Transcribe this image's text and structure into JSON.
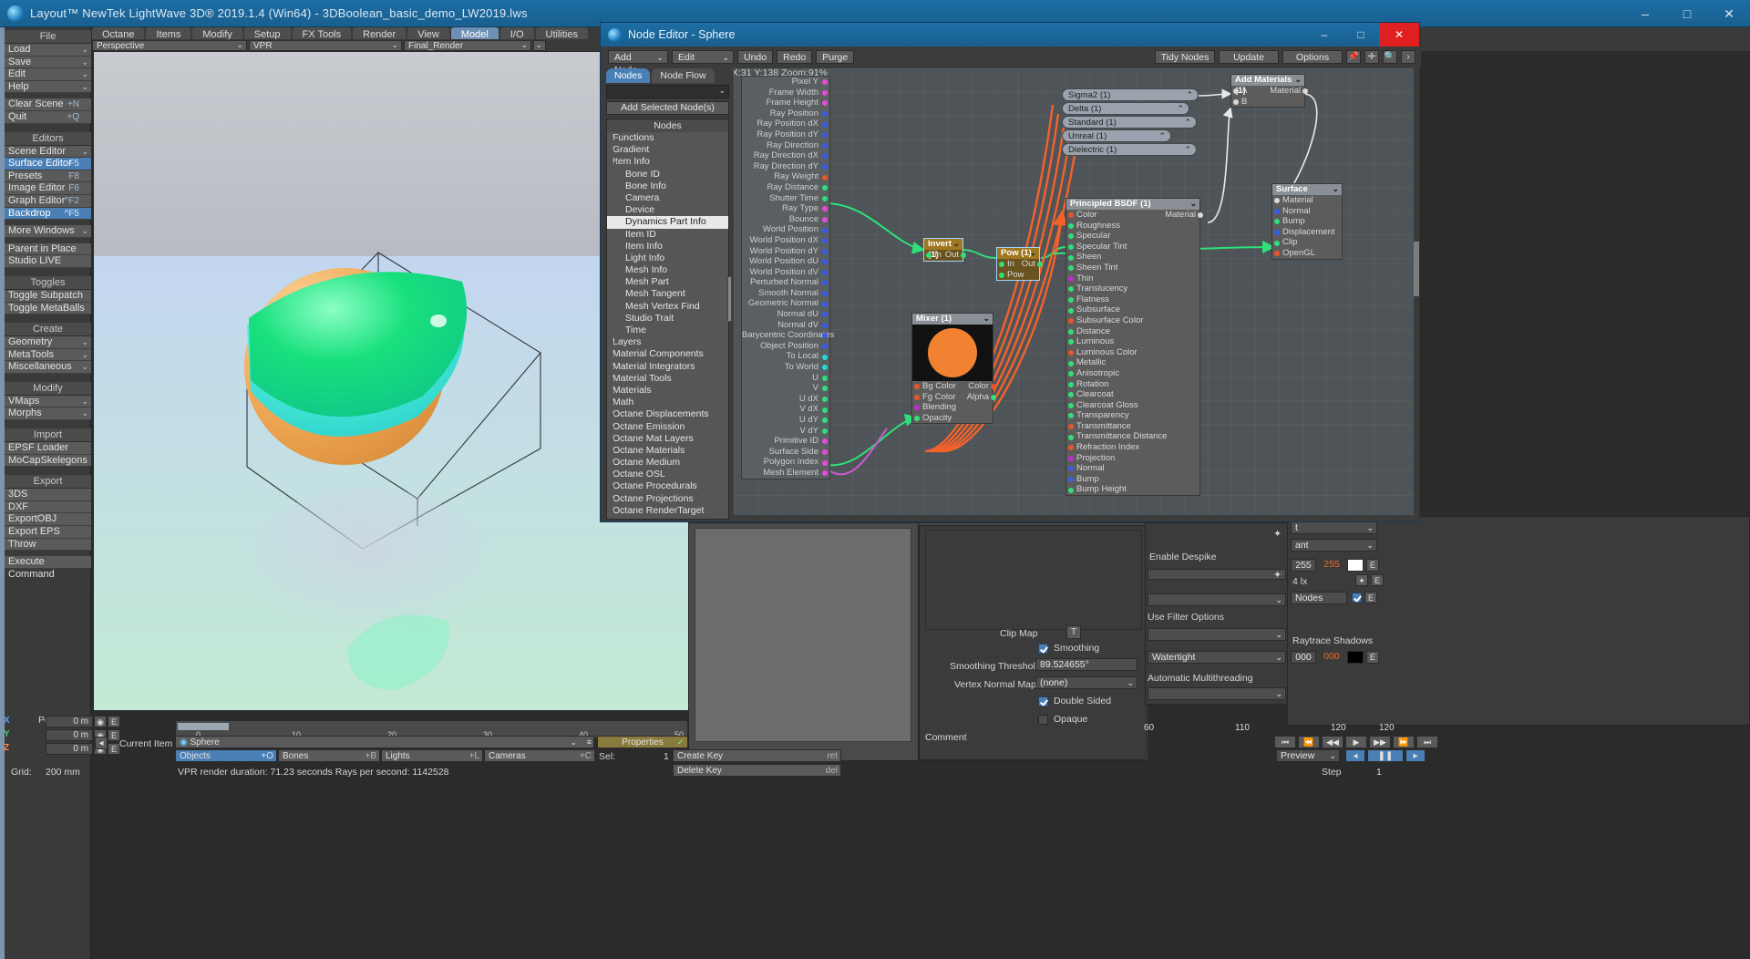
{
  "window": {
    "title": "Layout™ NewTek LightWave 3D® 2019.1.4 (Win64) - 3DBoolean_basic_demo_LW2019.lws",
    "minimize": "–",
    "maximize": "□",
    "close": "✕"
  },
  "sidebar": {
    "sections": [
      {
        "head": "File",
        "items": [
          {
            "label": "Load",
            "chev": "⌄"
          },
          {
            "label": "Save",
            "chev": "⌄"
          },
          {
            "label": "Edit",
            "chev": "⌄"
          },
          {
            "label": "Help",
            "chev": "⌄"
          }
        ]
      },
      {
        "head": "",
        "items": [
          {
            "label": "Clear Scene",
            "key": "+N"
          },
          {
            "label": "Quit",
            "key": "+Q"
          }
        ]
      },
      {
        "head": "Editors",
        "items": [
          {
            "label": "Scene Editor",
            "chev": "⌄"
          },
          {
            "label": "Surface Editor",
            "key": "F5",
            "sel": true
          },
          {
            "label": "Presets",
            "key": "F8"
          },
          {
            "label": "Image Editor",
            "key": "F6"
          },
          {
            "label": "Graph Editor",
            "key": "^F2"
          },
          {
            "label": "Backdrop",
            "key": "^F5",
            "sel": true
          }
        ]
      },
      {
        "head": "",
        "items": [
          {
            "label": "More Windows",
            "chev": "⌄"
          }
        ]
      },
      {
        "head": "",
        "items": [
          {
            "label": "Parent in Place"
          },
          {
            "label": "Studio LIVE"
          }
        ]
      },
      {
        "head": "Toggles",
        "items": [
          {
            "label": "Toggle Subpatch"
          },
          {
            "label": "Toggle MetaBalls"
          }
        ]
      },
      {
        "head": "Create",
        "items": [
          {
            "label": "Geometry",
            "chev": "⌄"
          },
          {
            "label": "MetaTools",
            "chev": "⌄"
          },
          {
            "label": "Miscellaneous",
            "chev": "⌄"
          }
        ]
      },
      {
        "head": "Modify",
        "items": [
          {
            "label": "VMaps",
            "chev": "⌄"
          },
          {
            "label": "Morphs",
            "chev": "⌄"
          }
        ]
      },
      {
        "head": "Import",
        "items": [
          {
            "label": "EPSF Loader"
          },
          {
            "label": "MoCapSkelegons"
          }
        ]
      },
      {
        "head": "Export",
        "items": [
          {
            "label": "3DS"
          },
          {
            "label": "DXF"
          },
          {
            "label": "ExportOBJ"
          },
          {
            "label": "Export EPS"
          },
          {
            "label": "Throw"
          }
        ]
      },
      {
        "head": "",
        "items": [
          {
            "label": "Execute Command"
          }
        ]
      }
    ]
  },
  "tabs": [
    {
      "label": "Octane",
      "active": false
    },
    {
      "label": "Items",
      "active": false
    },
    {
      "label": "Modify",
      "active": false
    },
    {
      "label": "Setup",
      "active": false
    },
    {
      "label": "FX Tools",
      "active": false
    },
    {
      "label": "Render",
      "active": false
    },
    {
      "label": "View",
      "active": false
    },
    {
      "label": "Model",
      "active": true
    },
    {
      "label": "I/O",
      "active": false
    },
    {
      "label": "Utilities",
      "active": false
    }
  ],
  "viewport_toolbar": {
    "view": "Perspective",
    "render_mode": "VPR",
    "render_target": "Final_Render"
  },
  "node_editor": {
    "title": "Node Editor - Sphere",
    "window_buttons": {
      "min": "–",
      "max": "□",
      "close": "✕"
    },
    "toolbar": {
      "add_node": "Add Node",
      "edit": "Edit",
      "undo": "Undo",
      "redo": "Redo",
      "purge": "Purge",
      "tidy_nodes": "Tidy Nodes",
      "update": "Update",
      "options": "Options",
      "icons": [
        "pin-icon",
        "move-icon",
        "search-icon",
        "chevron-right-icon"
      ]
    },
    "tabs": [
      {
        "label": "Nodes",
        "active": true
      },
      {
        "label": "Node Flow",
        "active": false
      }
    ],
    "search_placeholder": "",
    "add_selected": "Add Selected Node(s)",
    "tree_header": "Nodes",
    "tree": [
      {
        "label": "Functions",
        "arrow": "›",
        "level": 0
      },
      {
        "label": "Gradient",
        "arrow": "›",
        "level": 0
      },
      {
        "label": "Item Info",
        "arrow": "⌄",
        "level": 0
      },
      {
        "label": "Bone ID",
        "level": 1
      },
      {
        "label": "Bone Info",
        "level": 1
      },
      {
        "label": "Camera",
        "level": 1
      },
      {
        "label": "Device",
        "level": 1
      },
      {
        "label": "Dynamics Part Info",
        "level": 1,
        "sel": true
      },
      {
        "label": "Item ID",
        "level": 1
      },
      {
        "label": "Item Info",
        "level": 1
      },
      {
        "label": "Light Info",
        "level": 1
      },
      {
        "label": "Mesh Info",
        "level": 1
      },
      {
        "label": "Mesh Part",
        "level": 1
      },
      {
        "label": "Mesh Tangent",
        "level": 1
      },
      {
        "label": "Mesh Vertex Find",
        "level": 1
      },
      {
        "label": "Studio Trait",
        "level": 1
      },
      {
        "label": "Time",
        "level": 1
      },
      {
        "label": "Layers",
        "arrow": "›",
        "level": 0
      },
      {
        "label": "Material Components",
        "arrow": "›",
        "level": 0
      },
      {
        "label": "Material Integrators",
        "arrow": "›",
        "level": 0
      },
      {
        "label": "Material Tools",
        "arrow": "›",
        "level": 0
      },
      {
        "label": "Materials",
        "arrow": "›",
        "level": 0
      },
      {
        "label": "Math",
        "arrow": "›",
        "level": 0
      },
      {
        "label": "Octane Displacements",
        "arrow": "›",
        "level": 0
      },
      {
        "label": "Octane Emission",
        "arrow": "›",
        "level": 0
      },
      {
        "label": "Octane Mat Layers",
        "arrow": "›",
        "level": 0
      },
      {
        "label": "Octane Materials",
        "arrow": "›",
        "level": 0
      },
      {
        "label": "Octane Medium",
        "arrow": "›",
        "level": 0
      },
      {
        "label": "Octane OSL",
        "arrow": "›",
        "level": 0
      },
      {
        "label": "Octane Procedurals",
        "arrow": "›",
        "level": 0
      },
      {
        "label": "Octane Projections",
        "arrow": "›",
        "level": 0
      },
      {
        "label": "Octane RenderTarget",
        "arrow": "›",
        "level": 0
      }
    ],
    "canvas_status": "X:31 Y:138 Zoom:91%",
    "input_node": {
      "ports": [
        "Pixel Y",
        "Frame Width",
        "Frame Height",
        "Ray Position",
        "Ray Position dX",
        "Ray Position dY",
        "Ray Direction",
        "Ray Direction dX",
        "Ray Direction dY",
        "Ray Weight",
        "Ray Distance",
        "Shutter Time",
        "Ray Type",
        "Bounce",
        "World Position",
        "World Position dX",
        "World Position dY",
        "World Position dU",
        "World Position dV",
        "Perturbed Normal",
        "Smooth Normal",
        "Geometric Normal",
        "Normal dU",
        "Normal dV",
        "Barycentric Coordinates",
        "Object Position",
        "To Local",
        "To World",
        "U",
        "V",
        "U dX",
        "V dX",
        "U dY",
        "V dY",
        "Primitive ID",
        "Surface Side",
        "Polygon Index",
        "Mesh Element"
      ]
    },
    "invert_node": {
      "title": "Invert (1)",
      "in": "In",
      "out": "Out"
    },
    "pow_node": {
      "title": "Pow (1)",
      "in": "In",
      "pow": "Pow",
      "out": "Out"
    },
    "mixer_node": {
      "title": "Mixer (1)",
      "inputs": [
        "Bg Color",
        "Fg Color",
        "Blending",
        "Opacity"
      ],
      "outputs": [
        "Color",
        "Alpha"
      ],
      "swatch_color": "#f08232"
    },
    "collapsed_nodes": [
      {
        "title": "Sigma2 (1)"
      },
      {
        "title": "Delta (1)"
      },
      {
        "title": "Standard (1)"
      },
      {
        "title": "Unreal (1)"
      },
      {
        "title": "Dielectric (1)"
      }
    ],
    "add_materials_node": {
      "title": "Add Materials (1)",
      "inputs": [
        "A",
        "B"
      ],
      "outputs": [
        "Material"
      ]
    },
    "principled_node": {
      "title": "Principled BSDF (1)",
      "output": "Material",
      "inputs": [
        "Color",
        "Roughness",
        "Specular",
        "Specular Tint",
        "Sheen",
        "Sheen Tint",
        "Thin",
        "Translucency",
        "Flatness",
        "Subsurface",
        "Subsurface Color",
        "Distance",
        "Luminous",
        "Luminous Color",
        "Metallic",
        "Anisotropic",
        "Rotation",
        "Clearcoat",
        "Clearcoat Gloss",
        "Transparency",
        "Transmittance",
        "Transmittance Distance",
        "Refraction Index",
        "Projection",
        "Normal",
        "Bump",
        "Bump Height"
      ]
    },
    "surface_node": {
      "title": "Surface",
      "inputs": [
        "Material",
        "Normal",
        "Bump",
        "Displacement",
        "Clip",
        "OpenGL"
      ]
    }
  },
  "surface_editor": {
    "enable_despike": "Enable Despike",
    "clip_map": "Clip Map",
    "clip_map_btn": "T",
    "smoothing": "Smoothing",
    "smoothing_threshold_label": "Smoothing Threshold",
    "smoothing_threshold_value": "89.524655°",
    "vertex_normal_map_label": "Vertex Normal Map",
    "vertex_normal_map_value": "(none)",
    "double_sided": "Double Sided",
    "opaque": "Opaque",
    "comment": "Comment",
    "use_filter_options": "Use Filter Options",
    "watertight": "Watertight",
    "automatic_multithreading": "Automatic Multithreading",
    "nodes_label": "Nodes",
    "raytrace_shadows": "Raytrace Shadows",
    "color_r": "255",
    "color_g": "255",
    "lux_value": "4 lx",
    "shadow_vals": [
      "000",
      "000"
    ],
    "e_btn": "E",
    "ant_label": "ant",
    "t_label": "t"
  },
  "bottom": {
    "position_label": "Position",
    "axes": [
      {
        "name": "X",
        "value": "0 m"
      },
      {
        "name": "Y",
        "value": "0 m"
      },
      {
        "name": "Z",
        "value": "0 m"
      }
    ],
    "grid_label": "Grid:",
    "grid_value": "200 mm",
    "current_item_label": "Current Item",
    "current_item_value": "Sphere",
    "objects": "Objects",
    "objects_key": "+O",
    "bones": "Bones",
    "bones_key": "+B",
    "lights": "Lights",
    "lights_key": "+L",
    "cameras": "Cameras",
    "cameras_key": "+C",
    "properties": "Properties",
    "sel_label": "Sel:",
    "sel_value": "1",
    "create_key": "Create Key",
    "create_key_shortcut": "ret",
    "delete_key": "Delete Key",
    "delete_key_shortcut": "del",
    "vpr_status": "VPR render duration: 71.23 seconds  Rays per second: 1142528",
    "timeline_ticks": [
      "0",
      "10",
      "20",
      "30",
      "40",
      "50"
    ],
    "frame_value": "0",
    "right_ticks": [
      "60",
      "110",
      "120",
      "120"
    ],
    "preview": "Preview",
    "step_label": "Step",
    "step_value": "1",
    "transport": [
      "⏮",
      "⏪",
      "◀◀",
      "▶",
      "▶▶",
      "⏩",
      "⏭"
    ]
  }
}
